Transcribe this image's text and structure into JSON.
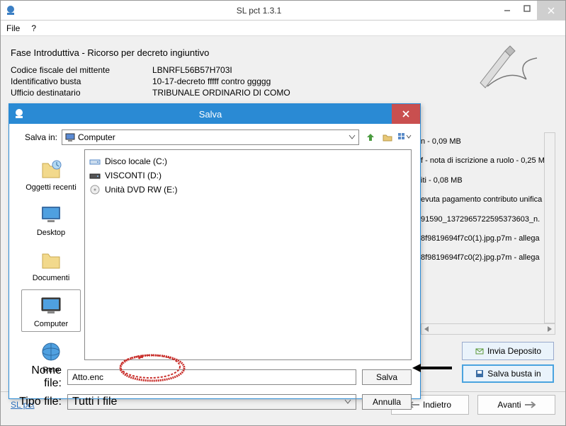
{
  "window": {
    "title": "SL pct 1.3.1",
    "menu": {
      "file": "File",
      "help": "?"
    }
  },
  "info": {
    "heading": "Fase Introduttiva - Ricorso per decreto ingiuntivo",
    "rows": [
      {
        "label": "Codice fiscale del mittente",
        "value": "LBNRFL56B57H703I"
      },
      {
        "label": "Identificativo busta",
        "value": "10-17-decreto fffff contro ggggg"
      },
      {
        "label": "Ufficio destinatario",
        "value": "TRIBUNALE ORDINARIO DI COMO"
      }
    ]
  },
  "bg_items": [
    "n - 0,09 MB",
    "f - nota di iscrizione a ruolo - 0,25 M",
    "iti - 0,08 MB",
    "evuta pagamento contributo unifica",
    "91590_1372965722595373603_n.",
    "8f9819694f7c0(1).jpg.p7m - allega",
    "8f9819694f7c0(2).jpg.p7m - allega"
  ],
  "right_buttons": {
    "invia": "Invia Deposito",
    "salva": "Salva busta in"
  },
  "bottom": {
    "link": "SL pct",
    "back": "Indietro",
    "next": "Avanti"
  },
  "dialog": {
    "title": "Salva",
    "save_in_label": "Salva in:",
    "save_in_value": "Computer",
    "places": {
      "recent": "Oggetti recenti",
      "desktop": "Desktop",
      "documents": "Documenti",
      "computer": "Computer",
      "network": "Rete"
    },
    "drives": [
      "Disco locale (C:)",
      "VISCONTI (D:)",
      "Unità DVD RW (E:)"
    ],
    "filename_label": "Nome file:",
    "filename_value": "Atto.enc",
    "filetype_label": "Tipo file:",
    "filetype_value": "Tutti i file",
    "save_btn": "Salva",
    "cancel_btn": "Annulla"
  }
}
